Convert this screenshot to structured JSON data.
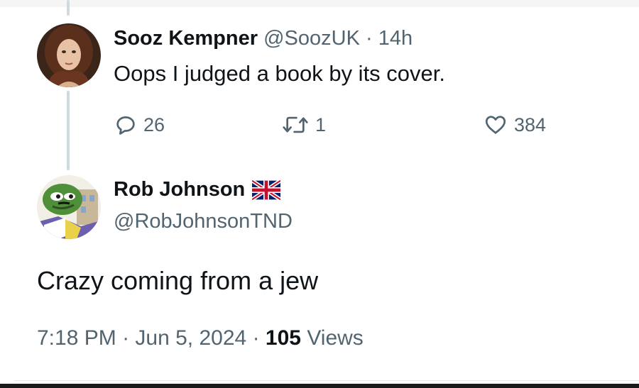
{
  "parent_tweet": {
    "author_name": "Sooz Kempner",
    "handle": "@SoozUK",
    "separator": "·",
    "time_ago": "14h",
    "text": "Oops I judged a book by its cover.",
    "replies": "26",
    "retweets": "1",
    "likes": "384",
    "avatar_icon": "person-photo-avatar"
  },
  "reply_tweet": {
    "author_name": "Rob Johnson",
    "flag_icon": "uk-flag-icon",
    "handle": "@RobJohnsonTND",
    "text": "Crazy coming from a jew",
    "time": "7:18 PM",
    "separator": "·",
    "date": "Jun 5, 2024",
    "views_count": "105",
    "views_label": "Views",
    "avatar_icon": "cartoon-frog-avatar"
  },
  "colors": {
    "text_primary": "#0f1419",
    "text_secondary": "#536471",
    "thread_line": "#cfd9de"
  }
}
